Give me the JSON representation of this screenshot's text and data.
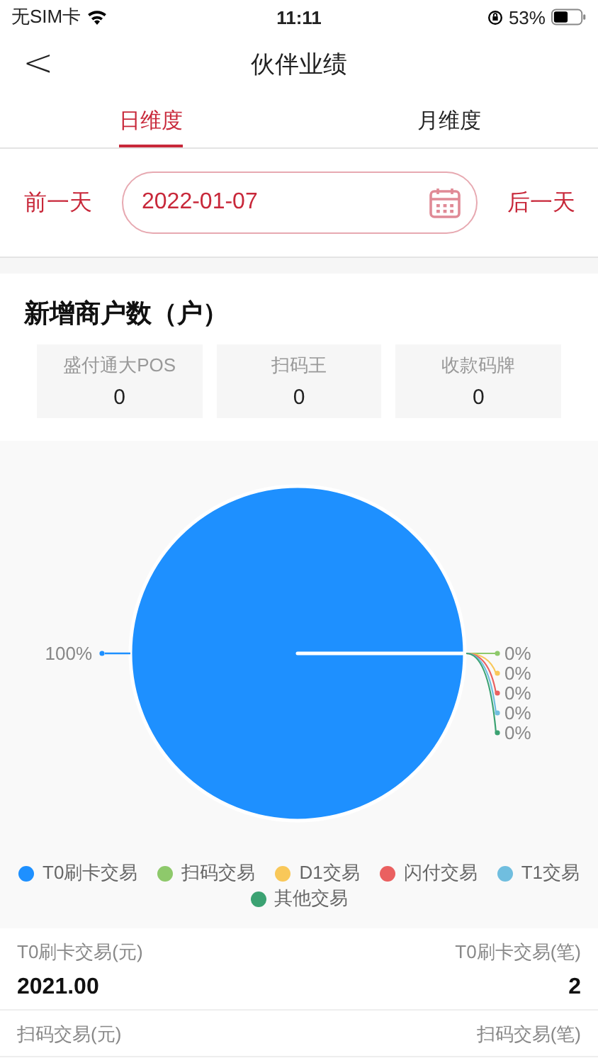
{
  "status_bar": {
    "carrier": "无SIM卡",
    "time": "11:11",
    "battery": "53%"
  },
  "nav": {
    "back": "<",
    "title": "伙伴业绩"
  },
  "tabs": [
    {
      "label": "日维度",
      "selected": true
    },
    {
      "label": "月维度",
      "selected": false
    }
  ],
  "date_picker": {
    "previous": "前一天",
    "value": "2022-01-07",
    "next": "后一天"
  },
  "new_merchants": {
    "title": "新增商户数（户）",
    "cards": [
      {
        "label": "盛付通大POS",
        "value": "0"
      },
      {
        "label": "扫码王",
        "value": "0"
      },
      {
        "label": "收款码牌",
        "value": "0"
      }
    ]
  },
  "chart": {
    "chart_data": {
      "type": "pie",
      "categories": [
        "T0刷卡交易",
        "扫码交易",
        "D1交易",
        "闪付交易",
        "T1交易",
        "其他交易"
      ],
      "values": [
        100,
        0,
        0,
        0,
        0,
        0
      ],
      "value_labels": [
        "100%",
        "0%",
        "0%",
        "0%",
        "0%",
        "0%"
      ]
    },
    "legend": [
      {
        "color": "#1e90ff"
      },
      {
        "color": "#8ec96b"
      },
      {
        "color": "#f9c859"
      },
      {
        "color": "#ea6060"
      },
      {
        "color": "#70bedf"
      },
      {
        "color": "#3ba272"
      }
    ]
  },
  "stats": [
    {
      "left_label": "T0刷卡交易(元)",
      "left_value": "2021.00",
      "right_label": "T0刷卡交易(笔)",
      "right_value": "2"
    },
    {
      "left_label": "扫码交易(元)",
      "right_label": "扫码交易(笔)"
    }
  ]
}
